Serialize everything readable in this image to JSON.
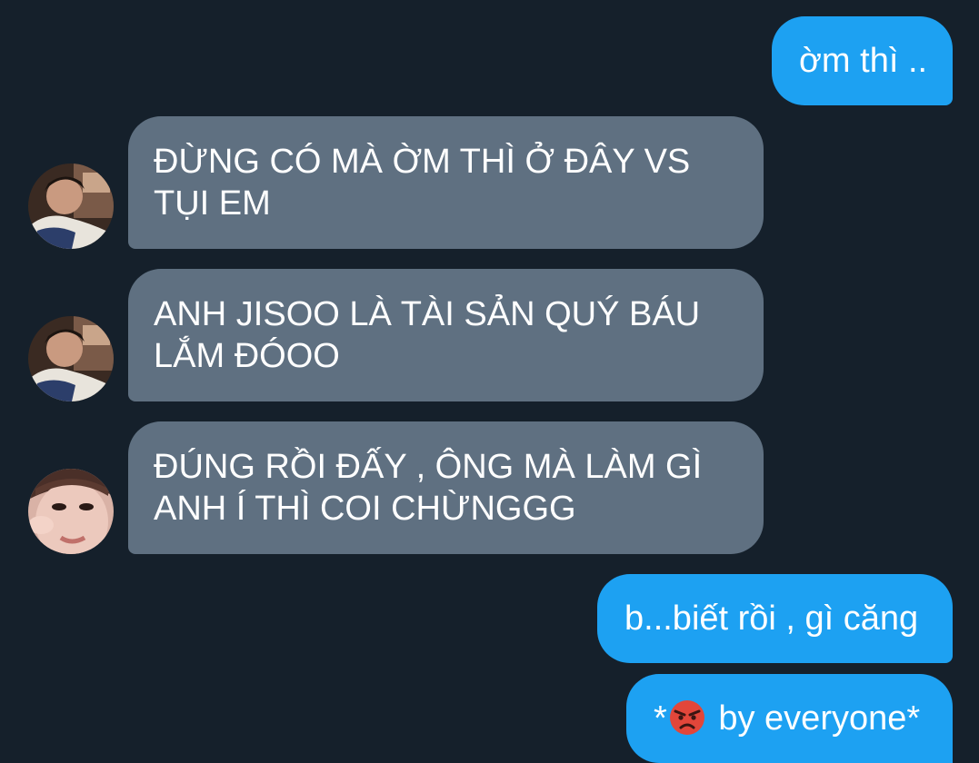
{
  "colors": {
    "background": "#15202b",
    "sent_bubble": "#1da1f2",
    "received_bubble": "#5f7081",
    "text": "#ffffff"
  },
  "messages": [
    {
      "direction": "sent",
      "text": "ờm thì .."
    },
    {
      "direction": "received",
      "avatar": "avatar-1",
      "text": "ĐỪNG CÓ MÀ ỜM THÌ Ở ĐÂY VS TỤI EM"
    },
    {
      "direction": "received",
      "avatar": "avatar-1",
      "text": "ANH JISOO LÀ TÀI SẢN QUÝ BÁU LẮM ĐÓOO"
    },
    {
      "direction": "received",
      "avatar": "avatar-2",
      "text": "ĐÚNG RỒI ĐẤY , ÔNG MÀ LÀM GÌ ANH Í THÌ COI CHỪNGGG"
    },
    {
      "direction": "sent",
      "text": "b...biết rồi , gì căng"
    },
    {
      "direction": "sent",
      "text_before": "*",
      "emoji": "angry-face-emoji",
      "text_after": " by everyone*"
    }
  ]
}
